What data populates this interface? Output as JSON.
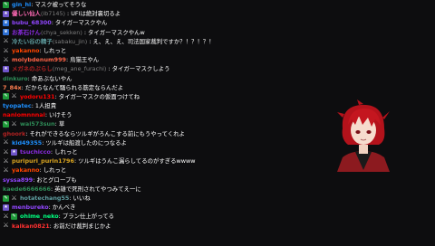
{
  "chat": {
    "messages": [
      {
        "badges": [
          "mod"
        ],
        "name": "gin_hi",
        "color": "#1e90ff",
        "text": "マスク被ってそうな"
      },
      {
        "badges": [
          "sub"
        ],
        "name": "優しい仙人",
        "reply": "(ib7145)",
        "color": "#ff69b4",
        "text": "UFIは絶対裏切るよ"
      },
      {
        "badges": [
          "prime"
        ],
        "name": "bubu_68300",
        "color": "#9146ff",
        "text": "タイガーマスクやん"
      },
      {
        "badges": [
          "prime"
        ],
        "name": "お茶石けん",
        "reply": "(chya_sekken)",
        "color": "#8a2be2",
        "text": "タイガーマスクやんw"
      },
      {
        "badges": [
          "sword"
        ],
        "name": "冷たい谷の精子",
        "reply": "(sabaku_jin)",
        "color": "#5f9ea0",
        "text": "え、え、え、司法国家裁判ですか？！？！？！"
      },
      {
        "badges": [
          "sword"
        ],
        "name": "yakanno",
        "color": "#ff4500",
        "text": "しれっと"
      },
      {
        "badges": [
          "sword"
        ],
        "name": "molybdenum999",
        "color": "#ff6347",
        "text": "烏猫王やん"
      },
      {
        "badges": [
          "sub"
        ],
        "name": "メガネのぷらし",
        "reply": "(meg_ane_furachi)",
        "color": "#b22222",
        "text": "タイガーマスクしよう"
      },
      {
        "badges": [],
        "name": "dinkuro",
        "color": "#2e8b57",
        "text": "命あぶないやん"
      },
      {
        "badges": [],
        "name": "7_84x",
        "color": "#ff7f50",
        "text": "だからなんて騒られる筋定ならんだよ"
      },
      {
        "badges": [
          "mod",
          "sword"
        ],
        "name": "yodoru131",
        "color": "#ff0000",
        "text": "タイガーマスクの仮面つけてね"
      },
      {
        "badges": [],
        "name": "tyopatec",
        "color": "#1e90ff",
        "text": "1人担責"
      },
      {
        "badges": [],
        "name": "naniomnnnai",
        "color": "#ff0000",
        "text": "いけそう"
      },
      {
        "badges": [
          "mod",
          "sword"
        ],
        "name": "wai573sun",
        "color": "#2e8b57",
        "text": "草"
      },
      {
        "badges": [],
        "name": "ghoork",
        "color": "#b22222",
        "text": "それができるならツルギがろんこする前にもうやってくれよ"
      },
      {
        "badges": [
          "sword"
        ],
        "name": "kid49355",
        "color": "#1e90ff",
        "text": "ツルギは船渡したのにつなるよ"
      },
      {
        "badges": [
          "sword",
          "sub"
        ],
        "name": "tsuchicco",
        "color": "#8a2be2",
        "text": "しれっと"
      },
      {
        "badges": [
          "sword"
        ],
        "name": "puripuri_purin1796",
        "color": "#daa520",
        "text": "ツルギはうんこ漏らしてるのがすぎるwwww"
      },
      {
        "badges": [
          "sword"
        ],
        "name": "yakanno",
        "color": "#ff4500",
        "text": "しれっと"
      },
      {
        "badges": [],
        "name": "syssa899",
        "color": "#9146ff",
        "text": "おとグロープも"
      },
      {
        "badges": [],
        "name": "kaede6666666",
        "color": "#2e8b57",
        "text": "英雄で死刑されてやつみてえ一に"
      },
      {
        "badges": [
          "mod",
          "sword"
        ],
        "name": "hotatechang55",
        "color": "#5f9ea0",
        "text": "いいね"
      },
      {
        "badges": [
          "sub"
        ],
        "name": "menbureko",
        "color": "#9146ff",
        "text": "かんべき"
      },
      {
        "badges": [
          "sword",
          "mod"
        ],
        "name": "ohime_neko",
        "color": "#00ff7f",
        "text": "プラン仕上がってる"
      },
      {
        "badges": [
          "sword"
        ],
        "name": "kaikan0821",
        "color": "#ff3030",
        "text": "お前だけ裁判まじかよ"
      }
    ]
  },
  "avatar": {
    "icon": "vtuber-avatar-red-hair"
  }
}
